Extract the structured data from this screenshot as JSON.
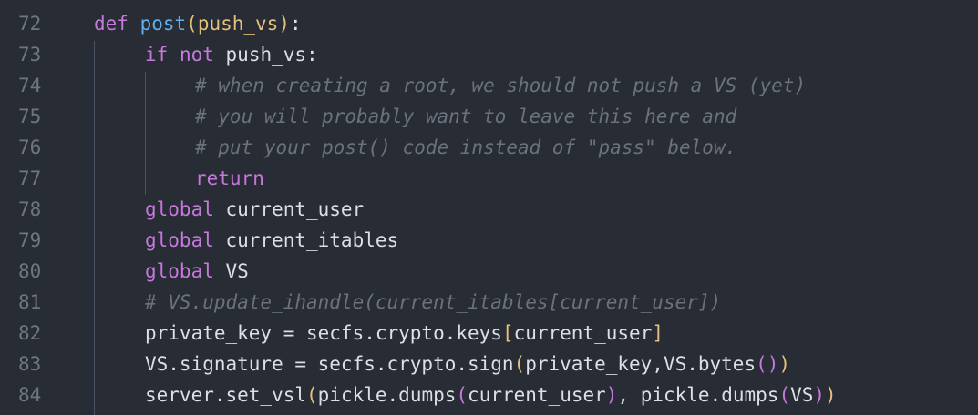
{
  "colors": {
    "background": "#282c34",
    "line_number": "#6e7681",
    "keyword": "#c678dd",
    "function": "#61afef",
    "parameter": "#e5c07b",
    "comment": "#6b717d",
    "text": "#dcdfe4"
  },
  "lines": [
    {
      "num": "72",
      "tokens": [
        "def",
        " ",
        "post",
        "(",
        "push_vs",
        ")",
        ":"
      ]
    },
    {
      "num": "73",
      "tokens": [
        "if",
        " ",
        "not",
        " push_vs:"
      ]
    },
    {
      "num": "74",
      "tokens": [
        "# when creating a root, we should not push a VS (yet)"
      ]
    },
    {
      "num": "75",
      "tokens": [
        "# you will probably want to leave this here and"
      ]
    },
    {
      "num": "76",
      "tokens": [
        "# put your post() code instead of \"pass\" below."
      ]
    },
    {
      "num": "77",
      "tokens": [
        "return"
      ]
    },
    {
      "num": "78",
      "tokens": [
        "global",
        " current_user"
      ]
    },
    {
      "num": "79",
      "tokens": [
        "global",
        " current_itables"
      ]
    },
    {
      "num": "80",
      "tokens": [
        "global",
        " VS"
      ]
    },
    {
      "num": "81",
      "tokens": [
        "# VS.update_ihandle(current_itables[current_user])"
      ]
    },
    {
      "num": "82",
      "tokens": [
        "private_key = secfs.crypto.keys",
        "[",
        "current_user",
        "]"
      ]
    },
    {
      "num": "83",
      "tokens": [
        "VS.signature = secfs.crypto.sign",
        "(",
        "private_key,VS.bytes",
        "(",
        ")",
        ")"
      ]
    },
    {
      "num": "84",
      "tokens": [
        "server.set_vsl",
        "(",
        "pickle.dumps",
        "(",
        "current_user",
        ")",
        ", pickle.dumps",
        "(",
        "VS",
        ")",
        ")"
      ]
    }
  ]
}
